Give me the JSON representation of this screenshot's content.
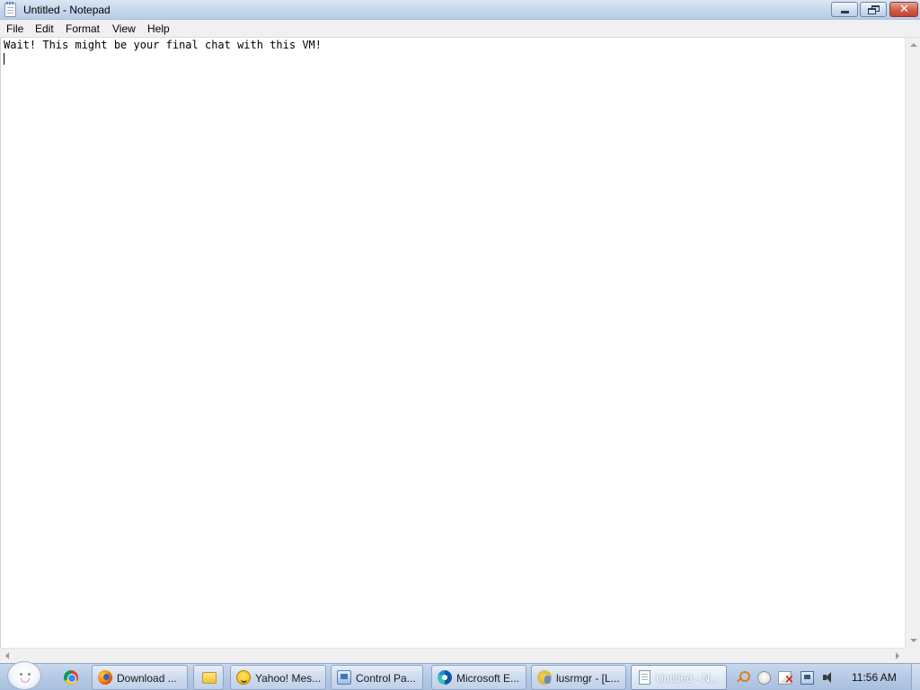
{
  "window": {
    "title": "Untitled - Notepad"
  },
  "menu": [
    "File",
    "Edit",
    "Format",
    "View",
    "Help"
  ],
  "editor": {
    "content": "Wait! This might be your final chat with this VM!"
  },
  "taskbar": {
    "buttons": [
      {
        "label": "Download ...",
        "icon": "firefox-icon"
      },
      {
        "label": "",
        "icon": "folder-icon"
      },
      {
        "label": "Yahoo! Mes...",
        "icon": "yahoo-messenger-icon"
      },
      {
        "label": "Control Pa...",
        "icon": "control-panel-icon"
      },
      {
        "label": "Microsoft E...",
        "icon": "edge-icon"
      },
      {
        "label": "lusrmgr - [L...",
        "icon": "lusrmgr-icon"
      },
      {
        "label": "Untitled - N...",
        "icon": "notepad-icon",
        "active": true
      }
    ],
    "quick_launch": [
      "chrome-icon"
    ],
    "tray_icons": [
      "search-icon",
      "messenger-tray-icon",
      "action-center-flag-icon",
      "network-icon",
      "volume-icon"
    ],
    "clock": "11:56 AM"
  }
}
